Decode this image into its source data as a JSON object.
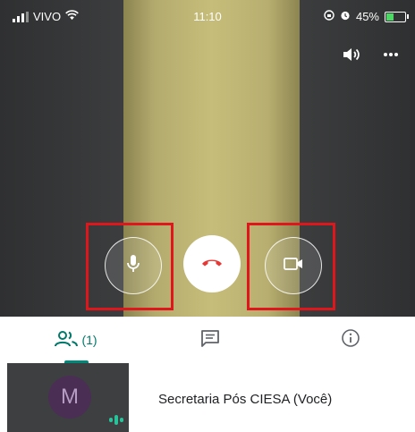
{
  "status_bar": {
    "carrier": "VIVO",
    "time": "11:10",
    "battery": "45%",
    "battery_level": 0.45
  },
  "tabs": {
    "people_count": "(1)"
  },
  "participant": {
    "initial": "M",
    "name": "Secretaria Pós CIESA (Você)"
  },
  "colors": {
    "accent": "#00897b",
    "end_call": "#e53935",
    "highlight": "#e0161d",
    "voice": "#27c39b"
  },
  "icons": [
    "signal-icon",
    "wifi-icon",
    "lock-rotation-icon",
    "alarm-icon",
    "battery-icon",
    "speaker-icon",
    "more-icon",
    "microphone-icon",
    "end-call-icon",
    "camera-icon",
    "people-icon",
    "chat-icon",
    "info-icon",
    "voice-activity-icon"
  ]
}
